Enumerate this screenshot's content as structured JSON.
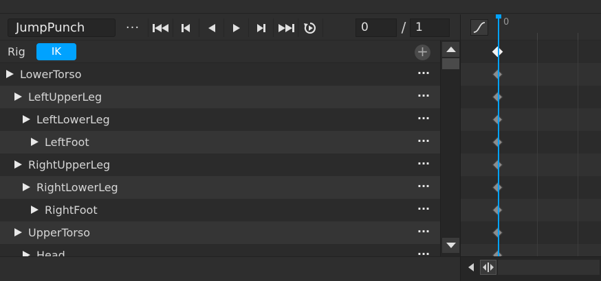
{
  "toolbar": {
    "animation_name": "JumpPunch",
    "more_label": "···",
    "current_frame": "0",
    "frame_separator": "/",
    "total_frames": "1"
  },
  "rig": {
    "label": "Rig",
    "ik_label": "IK",
    "add_label": "+"
  },
  "tracks": [
    {
      "name": "LowerTorso",
      "depth": 0
    },
    {
      "name": "LeftUpperLeg",
      "depth": 1
    },
    {
      "name": "LeftLowerLeg",
      "depth": 2
    },
    {
      "name": "LeftFoot",
      "depth": 3
    },
    {
      "name": "RightUpperLeg",
      "depth": 1
    },
    {
      "name": "RightLowerLeg",
      "depth": 2
    },
    {
      "name": "RightFoot",
      "depth": 3
    },
    {
      "name": "UpperTorso",
      "depth": 1
    },
    {
      "name": "Head",
      "depth": 2
    }
  ],
  "track_menu_label": "···",
  "timeline": {
    "ruler_start": "0"
  },
  "colors": {
    "accent": "#00a2ff",
    "background": "#2e2e2e"
  },
  "icons": [
    "curve-editor-icon",
    "first-frame-icon",
    "previous-keyframe-icon",
    "step-back-icon",
    "play-icon",
    "next-keyframe-icon",
    "last-frame-icon",
    "loop-icon",
    "scroll-left-icon"
  ]
}
